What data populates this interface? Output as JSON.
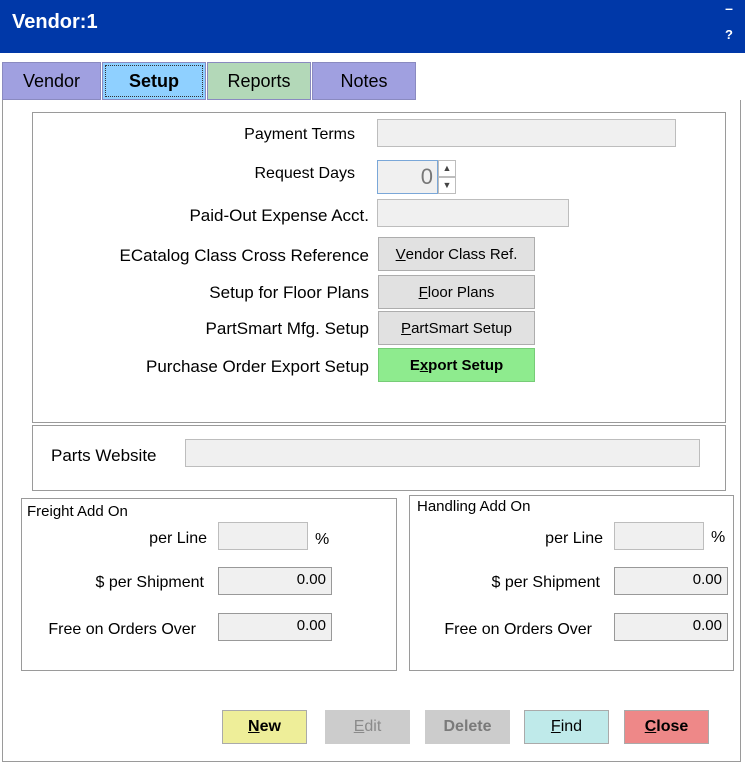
{
  "window": {
    "title": "Vendor:1",
    "minimize": "–",
    "help": "?"
  },
  "tabs": [
    {
      "label": "Vendor"
    },
    {
      "label": "Setup"
    },
    {
      "label": "Reports"
    },
    {
      "label": "Notes"
    }
  ],
  "setup": {
    "payment_terms_label": "Payment Terms",
    "payment_terms_value": "",
    "request_days_label": "Request Days",
    "request_days_value": "0",
    "paid_out_label": "Paid-Out Expense Acct.",
    "paid_out_value": "",
    "ecatalog_label": "ECatalog Class Cross Reference",
    "ecatalog_button_pre": "",
    "ecatalog_button_ul": "V",
    "ecatalog_button_post": "endor Class Ref.",
    "floor_label": "Setup for Floor Plans",
    "floor_button_pre": "",
    "floor_button_ul": "F",
    "floor_button_post": "loor Plans",
    "partsmart_label": "PartSmart Mfg. Setup",
    "partsmart_button_pre": "",
    "partsmart_button_ul": "P",
    "partsmart_button_post": "artSmart Setup",
    "po_export_label": "Purchase Order Export Setup",
    "po_export_button_pre": "E",
    "po_export_button_ul": "x",
    "po_export_button_post": "port Setup",
    "parts_website_label": "Parts Website",
    "parts_website_value": ""
  },
  "freight": {
    "title": "Freight Add On",
    "per_line_label": "per Line",
    "per_line_value": "",
    "percent": "%",
    "per_shipment_label": "$ per Shipment",
    "per_shipment_value": "0.00",
    "free_over_label": "Free on Orders Over",
    "free_over_value": "0.00"
  },
  "handling": {
    "title": "Handling Add On",
    "per_line_label": "per Line",
    "per_line_value": "",
    "percent": "%",
    "per_shipment_label": "$ per Shipment",
    "per_shipment_value": "0.00",
    "free_over_label": "Free on Orders Over",
    "free_over_value": "0.00"
  },
  "buttons": {
    "new_ul": "N",
    "new_post": "ew",
    "edit_ul": "E",
    "edit_post": "dit",
    "delete_label": "Delete",
    "find_ul": "F",
    "find_post": "ind",
    "close_ul": "C",
    "close_post": "lose"
  },
  "colors": {
    "titlebar": "#0038A8",
    "export_button": "#8EEB8E",
    "new_button": "#EEEE99",
    "find_button": "#BFEAEA",
    "close_button": "#EE8888",
    "disabled_button": "#CCCCCC"
  }
}
